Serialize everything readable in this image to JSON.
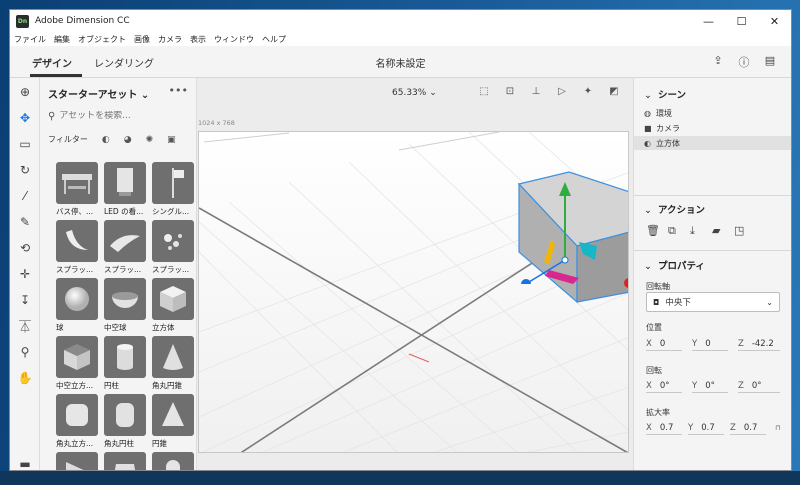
{
  "window": {
    "title": "Adobe Dimension CC",
    "logo": "Dn",
    "controls": {
      "minimize": "—",
      "maximize": "☐",
      "close": "✕"
    }
  },
  "menu": [
    "ファイル",
    "編集",
    "オブジェクト",
    "画像",
    "カメラ",
    "表示",
    "ウィンドウ",
    "ヘルプ"
  ],
  "tabs": {
    "design": "デザイン",
    "render": "レンダリング"
  },
  "document_title": "名称未設定",
  "top_icons": [
    "share-icon",
    "help-icon",
    "feedback-icon"
  ],
  "tools": [
    "add-icon",
    "select-icon",
    "frame-icon",
    "rotate-icon",
    "magic-wand-icon",
    "eyedropper-icon",
    "orbit-icon",
    "pan-icon",
    "dolly-icon",
    "horizon-icon",
    "zoom-icon",
    "hand-icon",
    "panel-icon"
  ],
  "assets": {
    "title": "スターターアセット",
    "more": "•••",
    "search_placeholder": "アセットを検索...",
    "filter_label": "フィルター",
    "items": [
      {
        "label": "バス停、..."
      },
      {
        "label": "LED の看..."
      },
      {
        "label": "シングル..."
      },
      {
        "label": "スプラッ..."
      },
      {
        "label": "スプラッ..."
      },
      {
        "label": "スプラッ..."
      },
      {
        "label": "球"
      },
      {
        "label": "中空球"
      },
      {
        "label": "立方体"
      },
      {
        "label": "中空立方..."
      },
      {
        "label": "円柱"
      },
      {
        "label": "角丸円錐"
      },
      {
        "label": "角丸立方..."
      },
      {
        "label": "角丸円柱"
      },
      {
        "label": "円錐"
      },
      {
        "label": ""
      },
      {
        "label": ""
      },
      {
        "label": ""
      }
    ]
  },
  "viewport": {
    "zoom": "65.33%",
    "canvas_size": "1024 x 768"
  },
  "scene": {
    "title": "シーン",
    "items": [
      {
        "label": "環境",
        "icon": "globe-icon"
      },
      {
        "label": "カメラ",
        "icon": "camera-icon"
      },
      {
        "label": "立方体",
        "icon": "cube-icon",
        "selected": true
      }
    ]
  },
  "actions": {
    "title": "アクション",
    "icons": [
      "delete-icon",
      "duplicate-icon",
      "drop-icon",
      "folder-icon",
      "export-icon"
    ]
  },
  "properties": {
    "title": "プロパティ",
    "pivot_label": "回転軸",
    "pivot_value": "中央下",
    "position_label": "位置",
    "position": {
      "x": "0",
      "y": "0",
      "z": "-42.2"
    },
    "rotation_label": "回転",
    "rotation": {
      "x": "0°",
      "y": "0°",
      "z": "0°"
    },
    "scale_label": "拡大率",
    "scale": {
      "x": "0.7",
      "y": "0.7",
      "z": "0.7"
    }
  }
}
